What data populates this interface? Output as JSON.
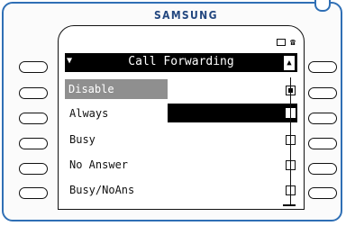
{
  "device": {
    "brand": "SAMSUNG"
  },
  "screen": {
    "status_icons": [
      "envelope-icon",
      "handset-icon"
    ],
    "status_text": "☎",
    "title": "Call Forwarding",
    "nav_left_glyph": "▼",
    "nav_right_glyph": "▲",
    "items": [
      {
        "label": "Disable",
        "checked": true,
        "selected": true
      },
      {
        "label": "Always",
        "checked": false,
        "selected": false,
        "focused": true
      },
      {
        "label": "Busy",
        "checked": false,
        "selected": false
      },
      {
        "label": "No Answer",
        "checked": false,
        "selected": false
      },
      {
        "label": "Busy/NoAns",
        "checked": false,
        "selected": false
      }
    ]
  },
  "colors": {
    "frame": "#2f6fb5",
    "brand": "#23477f",
    "selected_row": "#8f8f8f",
    "title_bar": "#000000"
  }
}
